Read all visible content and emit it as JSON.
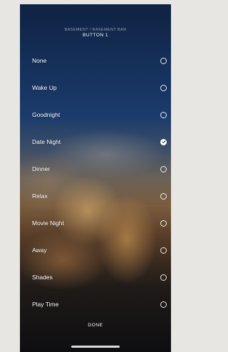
{
  "header": {
    "path": "BASEMENT / BASEMENT BAR",
    "title": "BUTTON 1"
  },
  "scenes": [
    {
      "label": "None",
      "selected": false
    },
    {
      "label": "Wake Up",
      "selected": false
    },
    {
      "label": "Goodnight",
      "selected": false
    },
    {
      "label": "Date Night",
      "selected": true
    },
    {
      "label": "Dinner",
      "selected": false
    },
    {
      "label": "Relax",
      "selected": false
    },
    {
      "label": "Movie Night",
      "selected": false
    },
    {
      "label": "Away",
      "selected": false
    },
    {
      "label": "Shades",
      "selected": false
    },
    {
      "label": "Play Time",
      "selected": false
    }
  ],
  "footer": {
    "done_label": "DONE"
  },
  "icons": {
    "radio_unselected": "radio-empty-icon",
    "radio_selected": "check-circle-icon"
  },
  "colors": {
    "text": "#ffffff",
    "page_background": "#e8e6e2"
  }
}
